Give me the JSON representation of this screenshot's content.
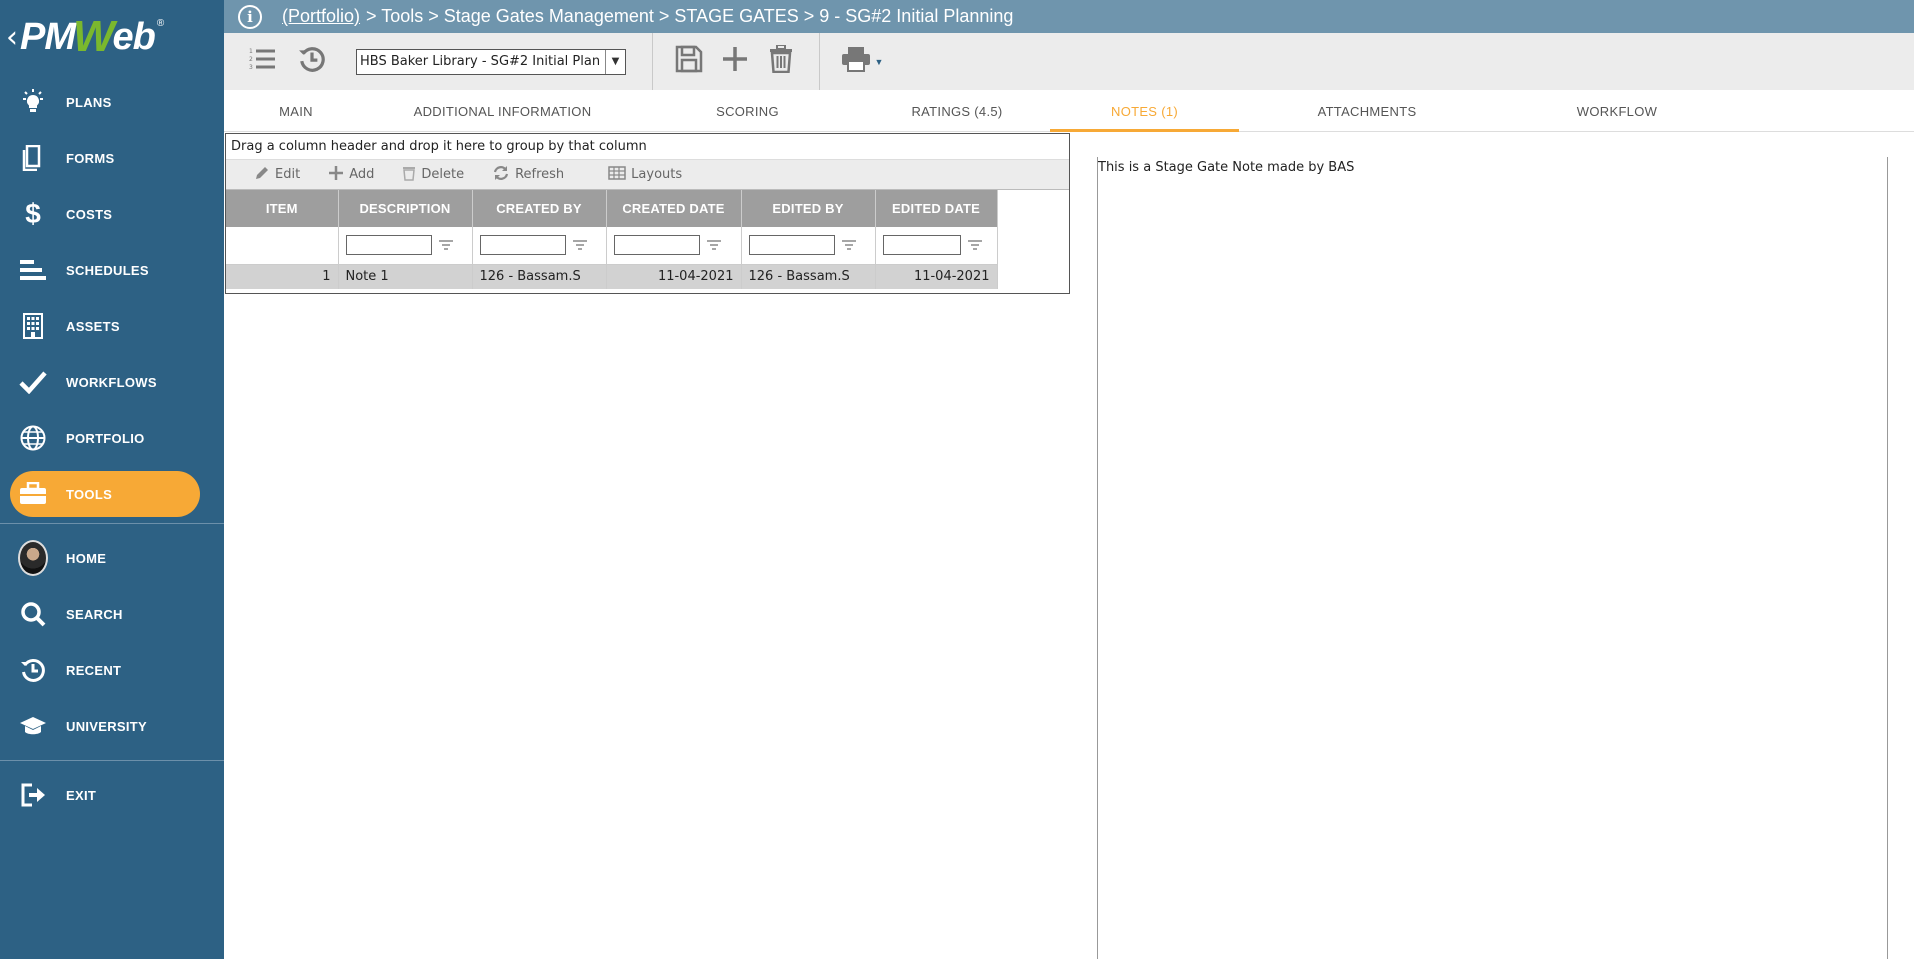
{
  "brand": {
    "logo_text_pm": "PM",
    "logo_text_w": "W",
    "logo_text_eb": "eb",
    "registered": "®"
  },
  "sidebar": {
    "items": [
      {
        "label": "PLANS",
        "icon": "lightbulb-icon"
      },
      {
        "label": "FORMS",
        "icon": "document-icon"
      },
      {
        "label": "COSTS",
        "icon": "dollar-icon"
      },
      {
        "label": "SCHEDULES",
        "icon": "gantt-icon"
      },
      {
        "label": "ASSETS",
        "icon": "building-icon"
      },
      {
        "label": "WORKFLOWS",
        "icon": "checkmark-icon"
      },
      {
        "label": "PORTFOLIO",
        "icon": "globe-icon"
      },
      {
        "label": "TOOLS",
        "icon": "toolbox-icon",
        "active": true
      }
    ],
    "secondary": [
      {
        "label": "HOME",
        "icon": "avatar"
      },
      {
        "label": "SEARCH",
        "icon": "search-icon"
      },
      {
        "label": "RECENT",
        "icon": "history-icon"
      },
      {
        "label": "UNIVERSITY",
        "icon": "graduation-cap-icon"
      }
    ],
    "exit": {
      "label": "EXIT",
      "icon": "exit-icon"
    },
    "colors": {
      "bg": "#2d6184",
      "active": "#f7a936"
    }
  },
  "breadcrumb": {
    "portfolio": "(Portfolio)",
    "rest": "> Tools > Stage Gates Management > STAGE GATES > 9 - SG#2 Initial Planning"
  },
  "toolbar": {
    "record_select_value": "HBS Baker Library - SG#2 Initial Plan"
  },
  "tabs": [
    {
      "label": "MAIN"
    },
    {
      "label": "ADDITIONAL INFORMATION"
    },
    {
      "label": "SCORING"
    },
    {
      "label": "RATINGS (4.5)"
    },
    {
      "label": "NOTES (1)",
      "active": true
    },
    {
      "label": "ATTACHMENTS"
    },
    {
      "label": "WORKFLOW"
    }
  ],
  "grid": {
    "group_hint": "Drag a column header and drop it here to group by that column",
    "actions": {
      "edit": "Edit",
      "add": "Add",
      "delete": "Delete",
      "refresh": "Refresh",
      "layouts": "Layouts"
    },
    "columns": [
      "ITEM",
      "DESCRIPTION",
      "CREATED BY",
      "CREATED DATE",
      "EDITED BY",
      "EDITED DATE"
    ],
    "rows": [
      {
        "item": "1",
        "description": "Note 1",
        "created_by": "126 - Bassam.S",
        "created_date": "11-04-2021",
        "edited_by": "126 - Bassam.S",
        "edited_date": "11-04-2021"
      }
    ]
  },
  "notes": {
    "text": "This is a Stage Gate Note made by BAS"
  }
}
